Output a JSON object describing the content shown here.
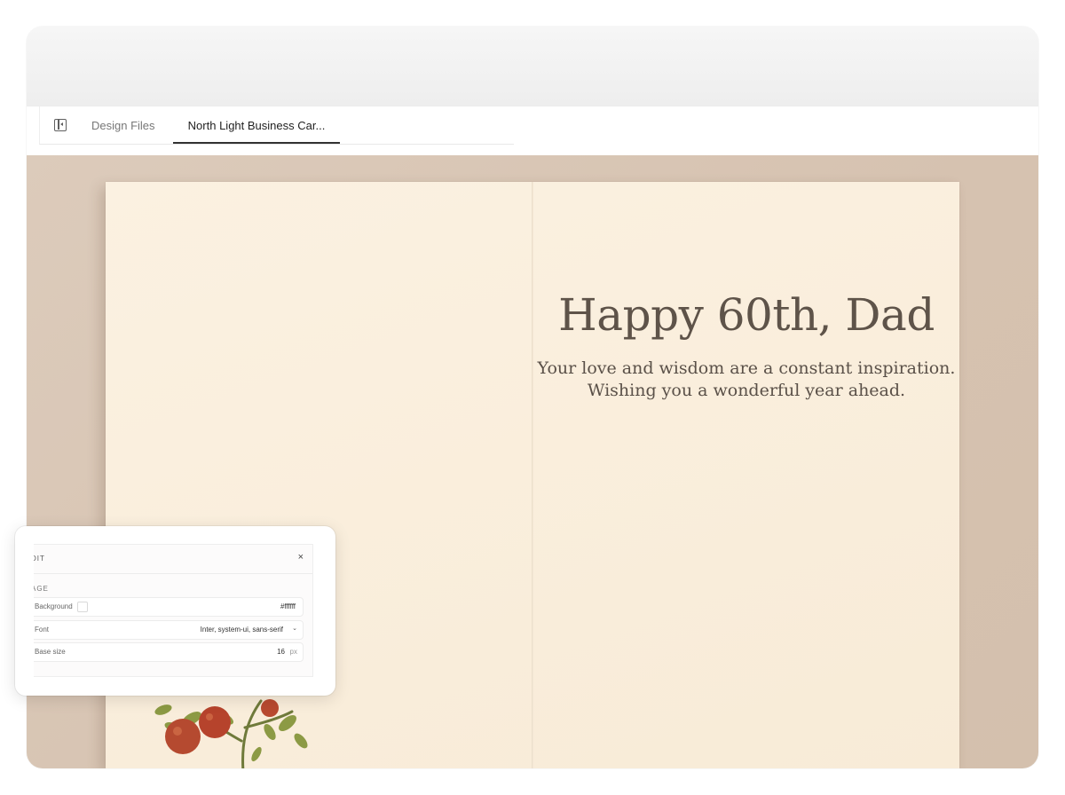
{
  "tabs": [
    {
      "label": "Design Files"
    },
    {
      "label": "North Light Business Car..."
    }
  ],
  "card": {
    "headline": "Happy 60th, Dad",
    "line1": "Your love and wisdom are a constant inspiration.",
    "line2": "Wishing you a wonderful year ahead."
  },
  "panel": {
    "title": "DIT",
    "close_glyph": "×",
    "section": "AGE",
    "rows": [
      {
        "label": "Background",
        "value": "#ffffff"
      },
      {
        "label": "Font",
        "value": "Inter, system-ui, sans-serif",
        "chevron": "⌄"
      },
      {
        "label": "Base size",
        "value": "16",
        "unit": "px"
      }
    ]
  },
  "colors": {
    "canvas": "#dac8b7",
    "card": "#fbf1e1",
    "text": "#5e5349"
  },
  "icons": [
    "sidebar-toggle-icon",
    "close-icon",
    "chevron-down-icon",
    "tomato-illustration"
  ]
}
